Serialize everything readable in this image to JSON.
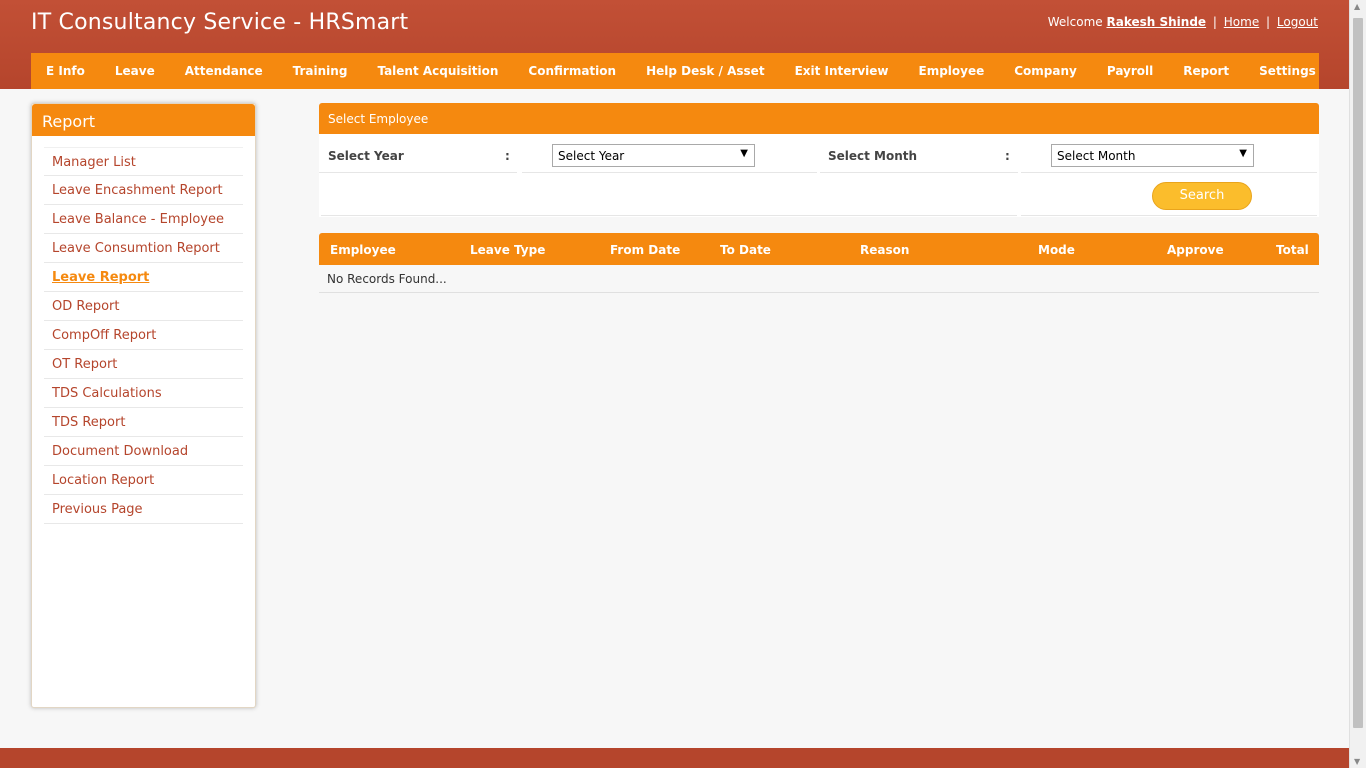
{
  "header": {
    "title": "IT Consultancy Service - HRSmart",
    "welcome_text": "Welcome",
    "user_name": "Rakesh Shinde",
    "home_link": "Home",
    "logout_link": "Logout",
    "separator": "|"
  },
  "nav": {
    "items": [
      "E Info",
      "Leave",
      "Attendance",
      "Training",
      "Talent Acquisition",
      "Confirmation",
      "Help Desk / Asset",
      "Exit Interview",
      "Employee",
      "Company",
      "Payroll",
      "Report",
      "Settings"
    ]
  },
  "sidebar": {
    "title": "Report",
    "items": [
      "Manager List",
      "Leave Encashment Report",
      "Leave Balance - Employee",
      "Leave Consumtion Report",
      "Leave Report",
      "OD Report",
      "CompOff Report",
      "OT Report",
      "TDS Calculations",
      "TDS Report",
      "Document Download",
      "Location Report",
      "Previous Page"
    ],
    "active": "Leave Report"
  },
  "filter": {
    "panel_title": "Select Employee",
    "year_label": "Select Year",
    "year_value": "Select Year",
    "month_label": "Select Month",
    "month_value": "Select Month",
    "colon": ":",
    "search_button": "Search"
  },
  "grid": {
    "columns": [
      "Employee",
      "Leave Type",
      "From Date",
      "To Date",
      "Reason",
      "Mode",
      "Approve",
      "Total"
    ],
    "empty_text": "No Records Found..."
  },
  "icons": {
    "dropdown": "triangle-down-icon"
  },
  "colors": {
    "header_bg": "#b5452c",
    "accent": "#f5890f",
    "button": "#fbbd2c"
  }
}
